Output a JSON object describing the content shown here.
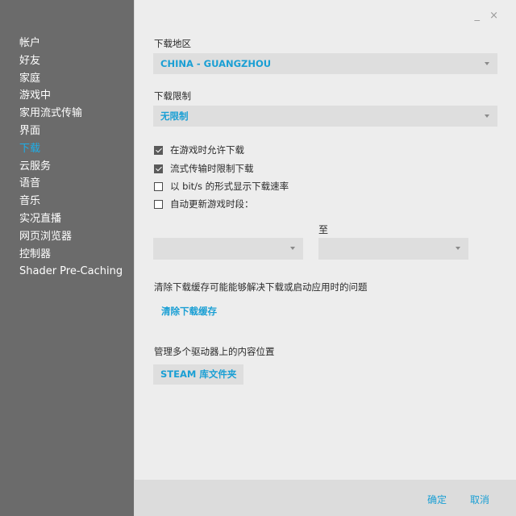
{
  "sidebar": {
    "items": [
      {
        "label": "帐户"
      },
      {
        "label": "好友"
      },
      {
        "label": "家庭"
      },
      {
        "label": "游戏中"
      },
      {
        "label": "家用流式传输"
      },
      {
        "label": "界面"
      },
      {
        "label": "下载"
      },
      {
        "label": "云服务"
      },
      {
        "label": "语音"
      },
      {
        "label": "音乐"
      },
      {
        "label": "实况直播"
      },
      {
        "label": "网页浏览器"
      },
      {
        "label": "控制器"
      },
      {
        "label": "Shader Pre-Caching"
      }
    ],
    "active_index": 6
  },
  "window_controls": {
    "minimize": "_",
    "close": "×"
  },
  "download_region": {
    "label": "下载地区",
    "value": "CHINA - GUANGZHOU"
  },
  "download_limit": {
    "label": "下载限制",
    "value": "无限制"
  },
  "checkboxes": [
    {
      "label": "在游戏时允许下载",
      "checked": true
    },
    {
      "label": "流式传输时限制下载",
      "checked": true
    },
    {
      "label": "以 bit/s 的形式显示下载速率",
      "checked": false
    },
    {
      "label": "自动更新游戏时段：",
      "checked": false
    }
  ],
  "schedule": {
    "to_label": "至",
    "from_value": "",
    "to_value": ""
  },
  "clear_cache": {
    "description": "清除下载缓存可能能够解决下载或启动应用时的问题",
    "button": "清除下载缓存"
  },
  "library": {
    "description": "管理多个驱动器上的内容位置",
    "button": "STEAM 库文件夹"
  },
  "footer": {
    "ok": "确定",
    "cancel": "取消"
  },
  "colors": {
    "accent": "#1a9fd4",
    "sidebar_bg": "#6b6b6b",
    "main_bg": "#ededed"
  }
}
